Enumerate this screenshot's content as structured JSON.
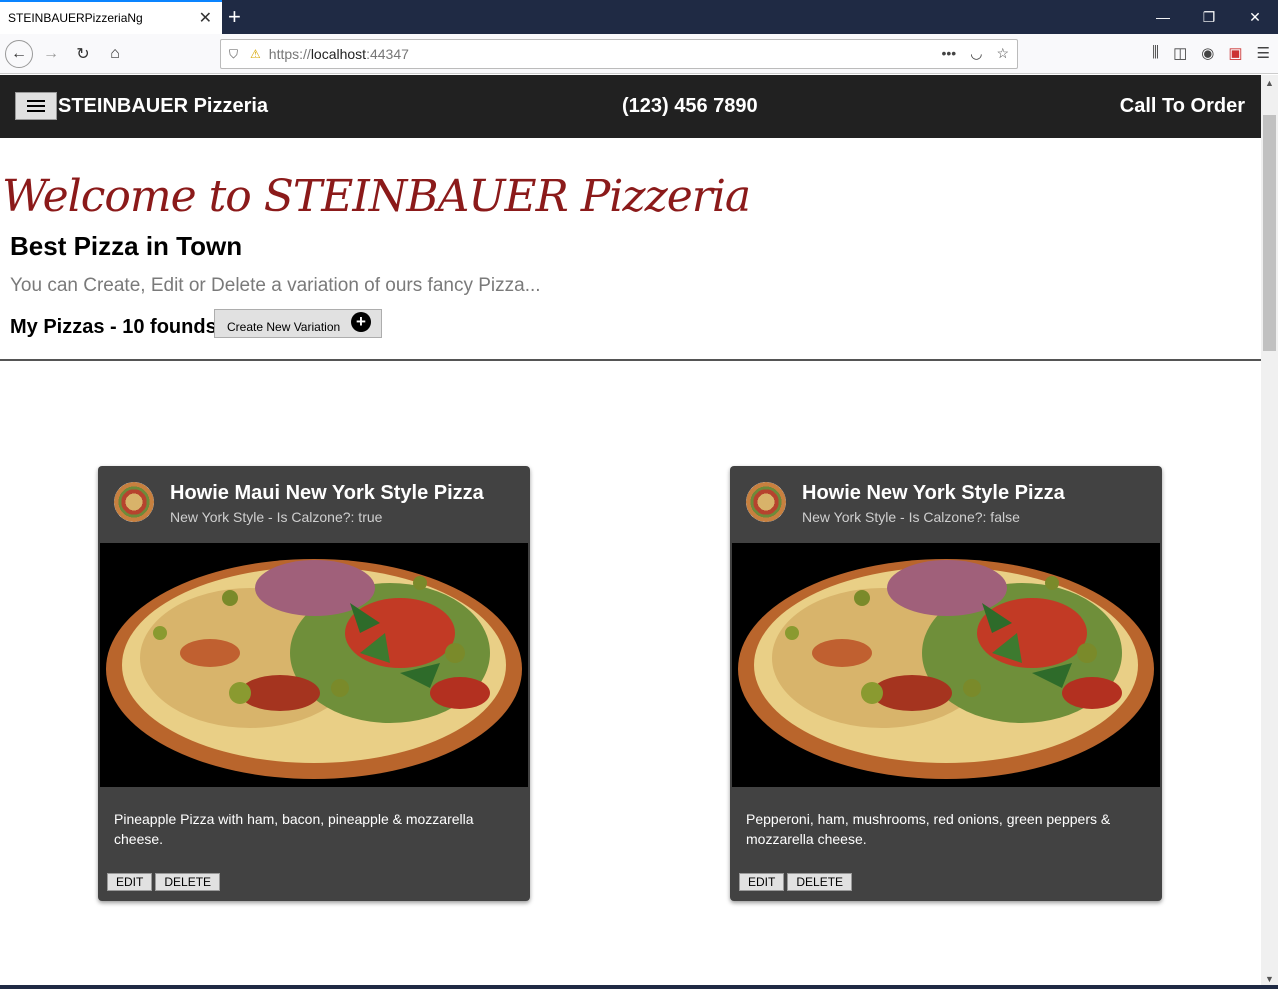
{
  "browser": {
    "tab_title": "STEINBAUERPizzeriaNg",
    "url_scheme": "https://",
    "url_host": "localhost",
    "url_port": ":44347"
  },
  "app": {
    "brand": "STEINBAUER Pizzeria",
    "phone": "(123) 456 7890",
    "cta": "Call To Order"
  },
  "hero": {
    "welcome": "Welcome to STEINBAUER Pizzeria",
    "subtitle": "Best Pizza in Town",
    "description": "You can Create, Edit or Delete a variation of ours fancy Pizza...",
    "count_label": "My Pizzas - 10 founds",
    "create_button": "Create New Variation"
  },
  "pizzas": [
    {
      "title": "Howie Maui New York Style Pizza",
      "subtitle": "New York Style - Is Calzone?: true",
      "description": "Pineapple Pizza with ham, bacon, pineapple & mozzarella cheese.",
      "edit_label": "EDIT",
      "delete_label": "DELETE"
    },
    {
      "title": "Howie New York Style Pizza",
      "subtitle": "New York Style - Is Calzone?: false",
      "description": "Pepperoni, ham, mushrooms, red onions, green peppers & mozzarella cheese.",
      "edit_label": "EDIT",
      "delete_label": "DELETE"
    }
  ],
  "colors": {
    "appbar": "#212121",
    "card": "#424242",
    "welcome": "#8b1a1a"
  }
}
